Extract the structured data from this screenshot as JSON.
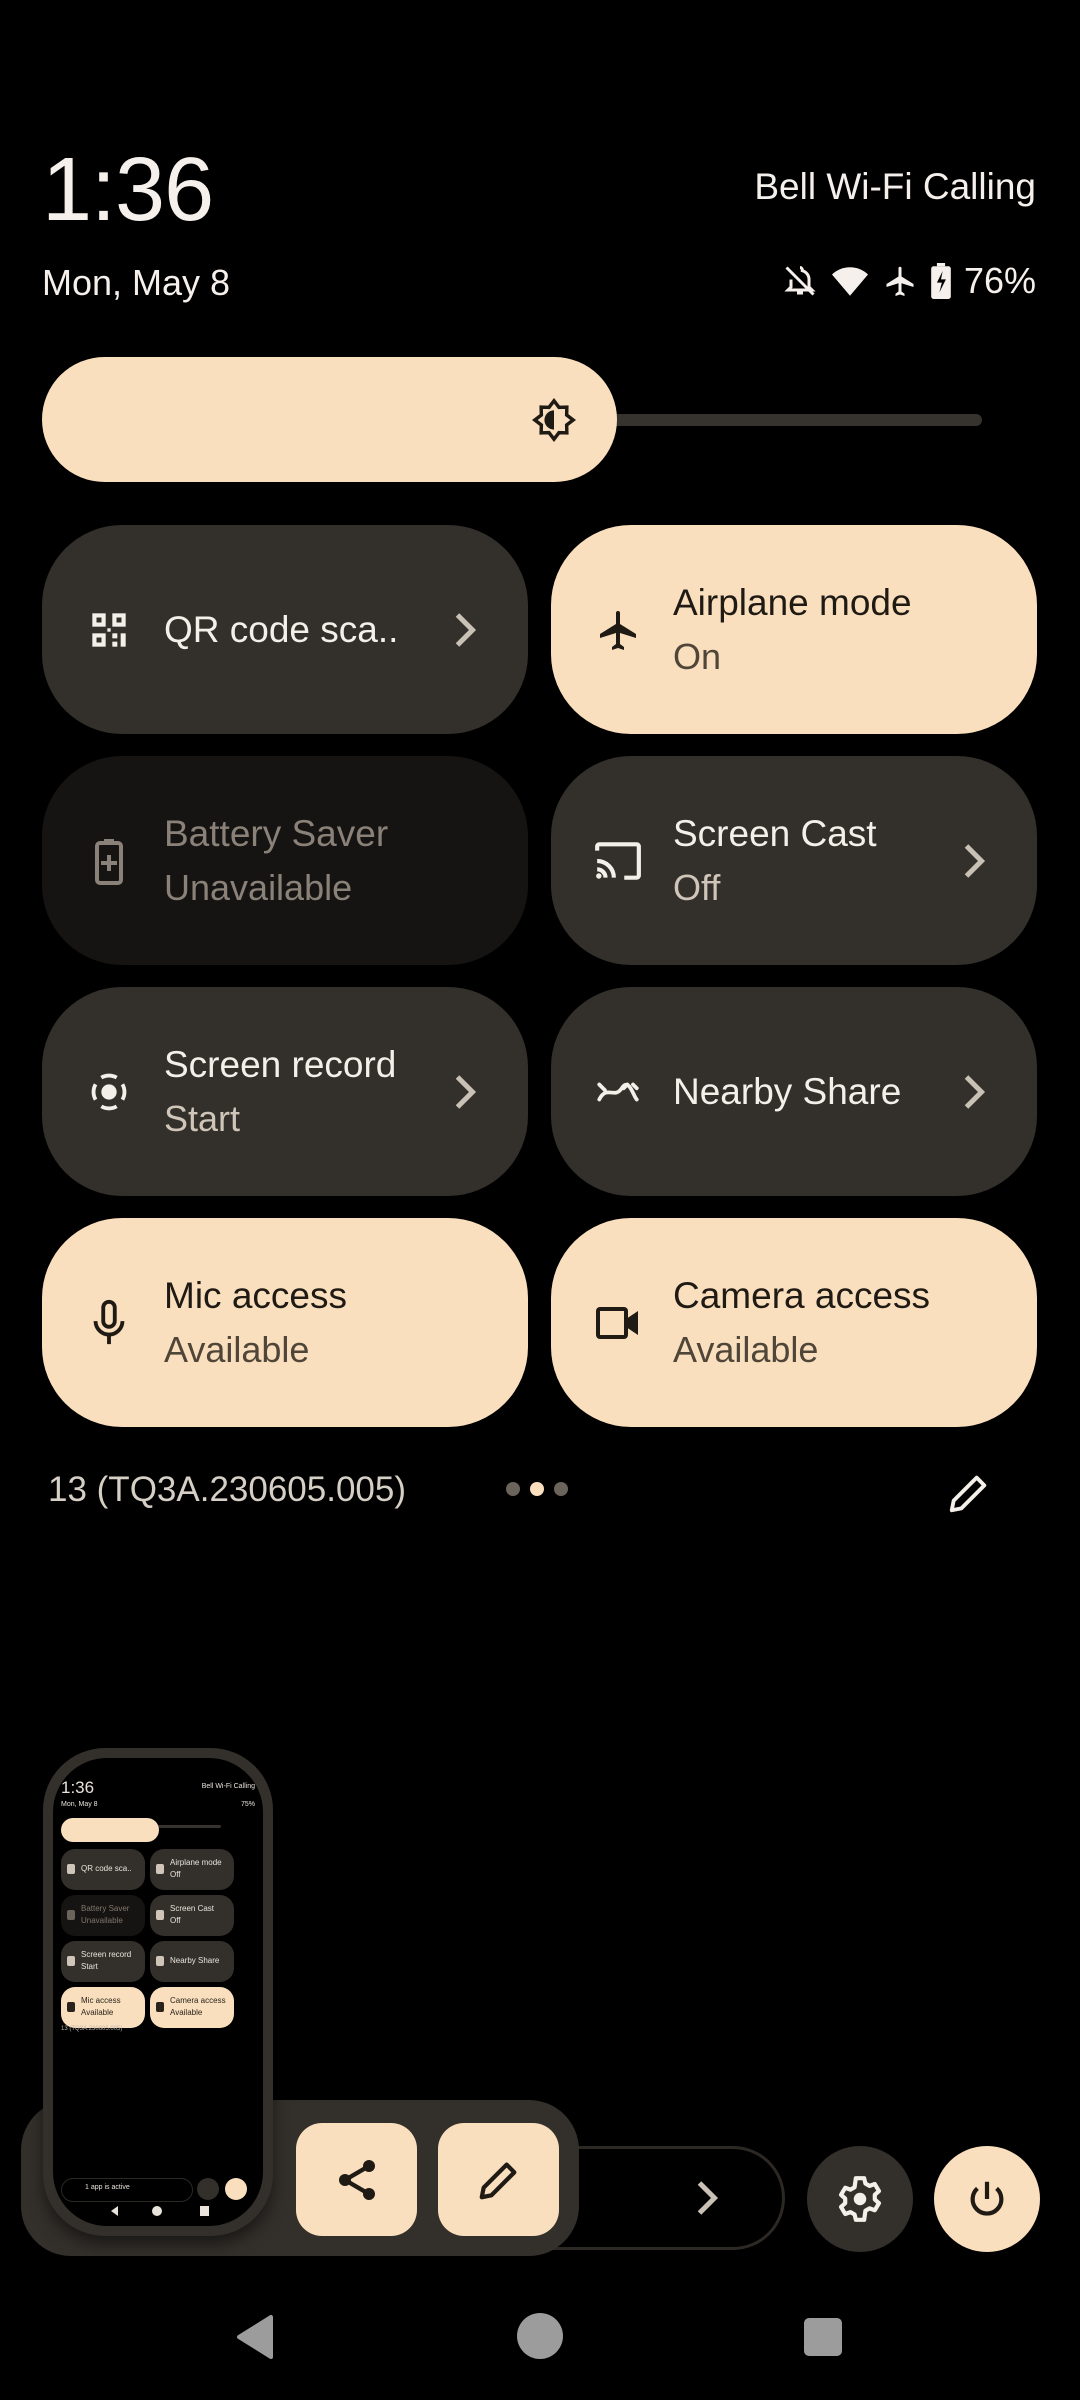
{
  "header": {
    "time": "1:36",
    "carrier": "Bell Wi-Fi Calling",
    "date": "Mon, May 8",
    "status_icons": [
      "bell-off-icon",
      "wifi-icon",
      "airplane-icon",
      "battery-charging-icon"
    ],
    "battery_percent": "76%"
  },
  "brightness": {
    "icon": "brightness-icon",
    "level": 0.62
  },
  "tiles": [
    {
      "id": "qr",
      "title": "QR code sca..",
      "subtitle": "",
      "state": "off",
      "icon": "qr-code-icon",
      "has_chevron": true
    },
    {
      "id": "airplane",
      "title": "Airplane mode",
      "subtitle": "On",
      "state": "on",
      "icon": "airplane-icon",
      "has_chevron": false
    },
    {
      "id": "battery-saver",
      "title": "Battery Saver",
      "subtitle": "Unavailable",
      "state": "unavailable",
      "icon": "battery-saver-icon",
      "has_chevron": false
    },
    {
      "id": "screen-cast",
      "title": "Screen Cast",
      "subtitle": "Off",
      "state": "off",
      "icon": "cast-icon",
      "has_chevron": true
    },
    {
      "id": "screen-record",
      "title": "Screen record",
      "subtitle": "Start",
      "state": "off",
      "icon": "screen-record-icon",
      "has_chevron": true
    },
    {
      "id": "nearby-share",
      "title": "Nearby Share",
      "subtitle": "",
      "state": "off",
      "icon": "nearby-share-icon",
      "has_chevron": true
    },
    {
      "id": "mic",
      "title": "Mic access",
      "subtitle": "Available",
      "state": "on",
      "icon": "mic-icon",
      "has_chevron": false
    },
    {
      "id": "camera",
      "title": "Camera access",
      "subtitle": "Available",
      "state": "on",
      "icon": "camera-icon",
      "has_chevron": false
    }
  ],
  "footer": {
    "build": "13 (TQ3A.230605.005)",
    "page_count": 3,
    "active_page": 2,
    "edit_icon": "pencil-icon"
  },
  "bottom_actions": {
    "settings_icon": "gear-icon",
    "power_icon": "power-icon"
  },
  "screenshot_preview": {
    "share_icon": "share-icon",
    "edit_icon": "pencil-icon",
    "thumbnail": {
      "time": "1:36",
      "carrier": "Bell Wi-Fi Calling",
      "date": "Mon, May 8",
      "battery_percent": "75%",
      "tiles": [
        {
          "title": "QR code sca..",
          "subtitle": "",
          "state": "off"
        },
        {
          "title": "Airplane mode",
          "subtitle": "Off",
          "state": "off"
        },
        {
          "title": "Battery Saver",
          "subtitle": "Unavailable",
          "state": "unavailable"
        },
        {
          "title": "Screen Cast",
          "subtitle": "Off",
          "state": "off"
        },
        {
          "title": "Screen record",
          "subtitle": "Start",
          "state": "off"
        },
        {
          "title": "Nearby Share",
          "subtitle": "",
          "state": "off"
        },
        {
          "title": "Mic access",
          "subtitle": "Available",
          "state": "on"
        },
        {
          "title": "Camera access",
          "subtitle": "Available",
          "state": "on"
        }
      ],
      "build": "13 (TQ3A.230605.005)",
      "active_apps": "1 app is active"
    }
  },
  "nav": {
    "back": "back-icon",
    "home": "home-icon",
    "recents": "recents-icon"
  },
  "colors": {
    "tile_active": "#f9dfbd",
    "tile_inactive": "#33302b",
    "tile_unavailable": "#161412",
    "background": "#000000"
  }
}
